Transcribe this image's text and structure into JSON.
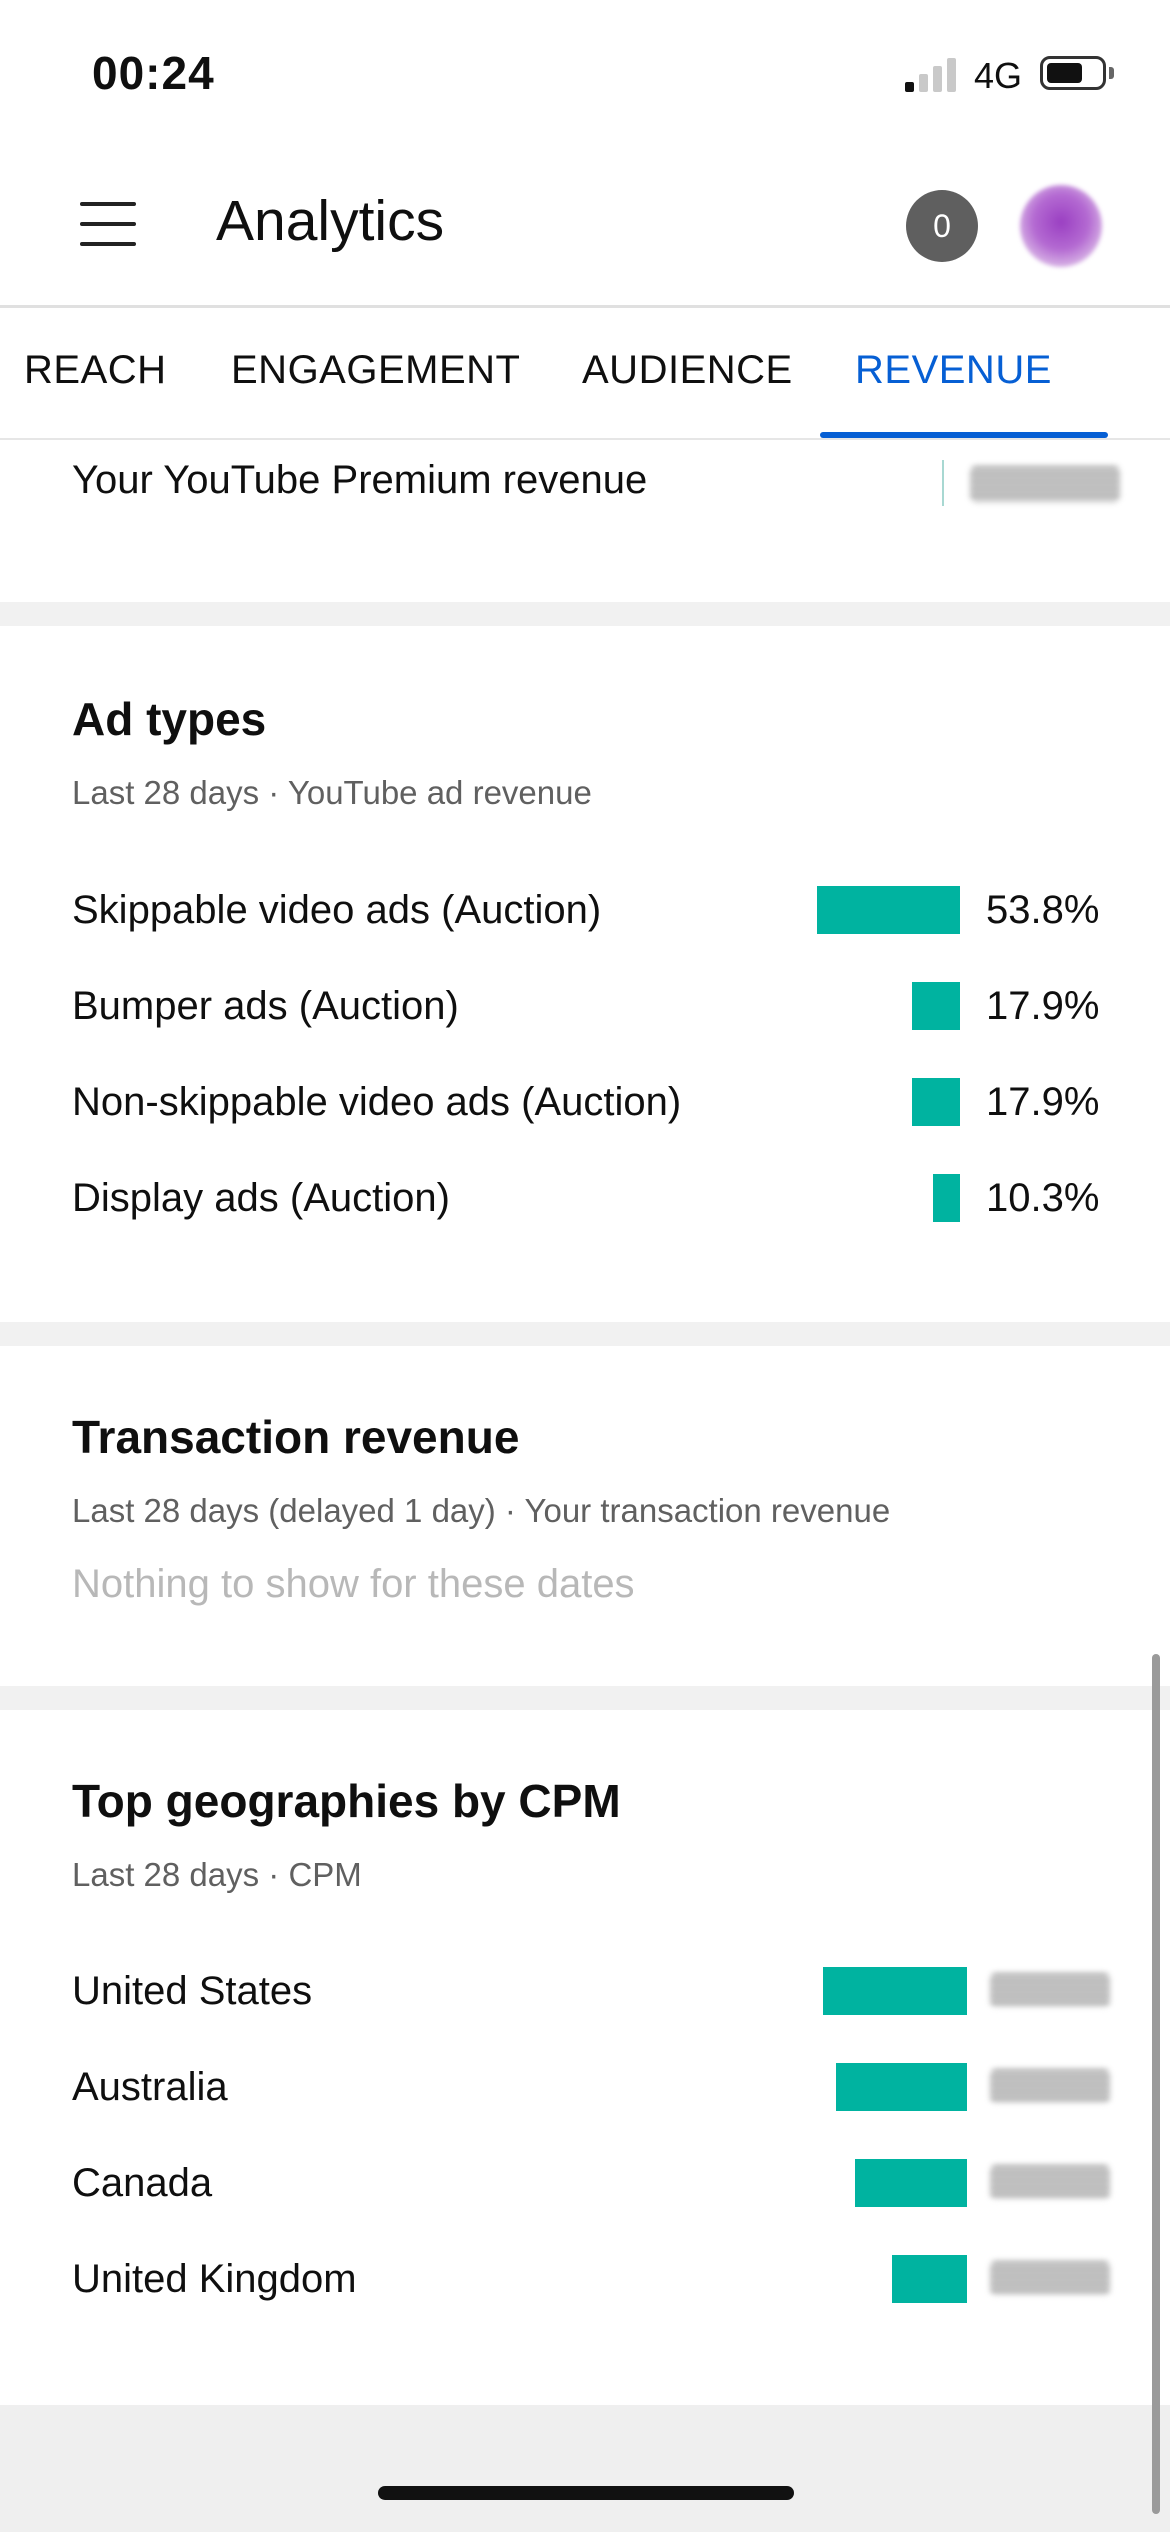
{
  "status_bar": {
    "time": "00:24",
    "network": "4G",
    "signal_bars_active": 1,
    "signal_bars_total": 4
  },
  "header": {
    "title": "Analytics",
    "notification_count": "0",
    "icons": [
      "menu-icon",
      "notification-badge",
      "avatar"
    ]
  },
  "tabs": [
    {
      "label": "REACH",
      "active": false
    },
    {
      "label": "ENGAGEMENT",
      "active": false
    },
    {
      "label": "AUDIENCE",
      "active": false
    },
    {
      "label": "REVENUE",
      "active": true
    }
  ],
  "premium": {
    "label": "Your YouTube Premium revenue"
  },
  "ad_types": {
    "title": "Ad types",
    "subtitle": "Last 28 days · YouTube ad revenue",
    "rows": [
      {
        "label": "Skippable video ads (Auction)",
        "value": "53.8%",
        "share": 53.8
      },
      {
        "label": "Bumper ads (Auction)",
        "value": "17.9%",
        "share": 17.9
      },
      {
        "label": "Non-skippable video ads (Auction)",
        "value": "17.9%",
        "share": 17.9
      },
      {
        "label": "Display ads (Auction)",
        "value": "10.3%",
        "share": 10.3
      }
    ]
  },
  "transaction": {
    "title": "Transaction revenue",
    "subtitle": "Last 28 days (delayed 1 day) · Your transaction revenue",
    "empty_message": "Nothing to show for these dates"
  },
  "geographies": {
    "title": "Top geographies by CPM",
    "subtitle": "Last 28 days · CPM",
    "rows": [
      {
        "label": "United States",
        "relative": 1.0
      },
      {
        "label": "Australia",
        "relative": 0.91
      },
      {
        "label": "Canada",
        "relative": 0.78
      },
      {
        "label": "United Kingdom",
        "relative": 0.52
      }
    ]
  },
  "colors": {
    "accent": "#065fd4",
    "bar": "#00b3a0",
    "text": "#0f0f0f",
    "secondary_text": "#606060",
    "muted_text": "#b8b8b8",
    "section_gap": "#f1f1f1"
  }
}
